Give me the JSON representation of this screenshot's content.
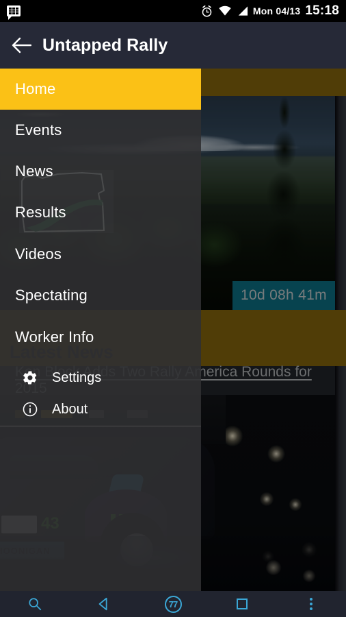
{
  "status_bar": {
    "notification_icon": "bbm-message-icon",
    "alarm_icon": "alarm-clock-icon",
    "wifi_icon": "wifi-icon",
    "signal_icon": "cellular-signal-icon",
    "date": "Mon 04/13",
    "time": "15:18"
  },
  "app_bar": {
    "back_icon": "back-arrow-icon",
    "title": "Untapped Rally"
  },
  "drawer": {
    "items": [
      {
        "label": "Home",
        "active": true
      },
      {
        "label": "Events",
        "active": false
      },
      {
        "label": "News",
        "active": false
      },
      {
        "label": "Results",
        "active": false
      },
      {
        "label": "Videos",
        "active": false
      },
      {
        "label": "Spectating",
        "active": false
      },
      {
        "label": "Worker Info",
        "active": false
      }
    ],
    "sub_items": [
      {
        "label": "Settings",
        "icon": "gear-icon"
      },
      {
        "label": "About",
        "icon": "info-icon"
      }
    ],
    "watermark": "oregon-road-logo"
  },
  "content": {
    "countdown": "10d 08h 41m",
    "latest_news_heading": "Latest News",
    "news_link": "Ken Block Adds Two Rally America Rounds for 2015",
    "hoonigan_text": "HOONIGAN",
    "car_number": "43"
  },
  "nav_bar": {
    "buttons": [
      {
        "name": "search-icon",
        "label": "Search"
      },
      {
        "name": "back-icon",
        "label": "Back"
      },
      {
        "name": "home-icon",
        "label": "77"
      },
      {
        "name": "recents-icon",
        "label": "Recents"
      },
      {
        "name": "overflow-icon",
        "label": "Menu"
      }
    ],
    "home_label": "77"
  },
  "colors": {
    "accent_yellow": "#fbc116",
    "olive_band": "#8a6a0d",
    "teal_badge": "#0d7489",
    "app_bar": "#262937",
    "nav_bar": "#21242f",
    "nav_icon_blue": "#3ba7d6"
  }
}
